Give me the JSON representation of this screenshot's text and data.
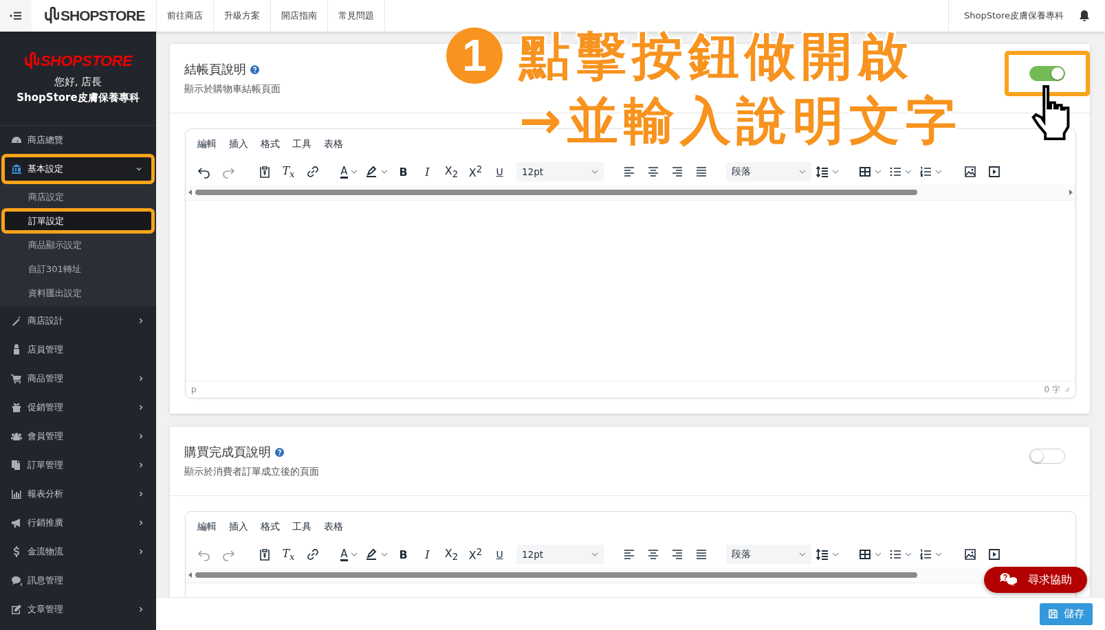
{
  "topbar": {
    "logo": "SHOPSTORE",
    "nav": [
      "前往商店",
      "升級方案",
      "開店指南",
      "常見問題"
    ],
    "store_name": "ShopStore皮膚保養專科"
  },
  "sidebar": {
    "logo": "SHOPSTORE",
    "greeting": "您好, 店長",
    "store_name": "ShopStore皮膚保養專科",
    "items": [
      {
        "kind": "dashboard",
        "label": "商店總覽",
        "selected": false,
        "highlighted": false
      },
      {
        "kind": "bank",
        "label": "基本設定",
        "selected": true,
        "highlighted": true,
        "expanded": true,
        "children": [
          {
            "label": "商店設定",
            "selected": false,
            "highlighted": false
          },
          {
            "label": "訂單設定",
            "selected": true,
            "highlighted": true
          },
          {
            "label": "商品顯示設定",
            "selected": false,
            "highlighted": false
          },
          {
            "label": "自訂301轉址",
            "selected": false,
            "highlighted": false
          },
          {
            "label": "資料匯出設定",
            "selected": false,
            "highlighted": false
          }
        ]
      },
      {
        "kind": "wand",
        "label": "商店設計",
        "selected": false,
        "highlighted": false,
        "expanded": false
      },
      {
        "kind": "user",
        "label": "店員管理",
        "selected": false,
        "highlighted": false
      },
      {
        "kind": "cart",
        "label": "商品管理",
        "selected": false,
        "highlighted": false,
        "expanded": false
      },
      {
        "kind": "gift",
        "label": "促銷管理",
        "selected": false,
        "highlighted": false,
        "expanded": false
      },
      {
        "kind": "users",
        "label": "會員管理",
        "selected": false,
        "highlighted": false,
        "expanded": false
      },
      {
        "kind": "copy",
        "label": "訂單管理",
        "selected": false,
        "highlighted": false,
        "expanded": false
      },
      {
        "kind": "chart",
        "label": "報表分析",
        "selected": false,
        "highlighted": false,
        "expanded": false
      },
      {
        "kind": "bullhorn",
        "label": "行銷推廣",
        "selected": false,
        "highlighted": false,
        "expanded": false
      },
      {
        "kind": "dollar",
        "label": "金流物流",
        "selected": false,
        "highlighted": false,
        "expanded": false
      },
      {
        "kind": "comments",
        "label": "訊息管理",
        "selected": false,
        "highlighted": false
      },
      {
        "kind": "edit",
        "label": "文章管理",
        "selected": false,
        "highlighted": false,
        "expanded": false
      }
    ]
  },
  "sections": [
    {
      "title": "結帳頁說明",
      "subtitle": "顯示於購物車結帳頁面",
      "toggle": {
        "on": true,
        "highlighted": true
      },
      "editor": {
        "menu": [
          "編輯",
          "插入",
          "格式",
          "工具",
          "表格"
        ],
        "history": [
          {
            "kind": "undo",
            "disabled": false
          },
          {
            "kind": "redo",
            "disabled": true
          }
        ],
        "glyphs": {
          "clear_format": "T$_{x}$",
          "forecolor": "A",
          "bold": "B",
          "italic": "I",
          "subscript": "X$_{2}$",
          "superscript": "X$^{2}$",
          "underline": "U"
        },
        "font_size": "12pt",
        "block": "段落",
        "status_path": "p",
        "word_count": "0 字"
      }
    },
    {
      "title": "購買完成頁說明",
      "subtitle": "顯示於消費者訂單成立後的頁面",
      "toggle": {
        "on": false,
        "highlighted": false
      },
      "editor": {
        "menu": [
          "編輯",
          "插入",
          "格式",
          "工具",
          "表格"
        ],
        "history": [
          {
            "kind": "undo",
            "disabled": true
          },
          {
            "kind": "redo",
            "disabled": true
          }
        ],
        "glyphs": {
          "clear_format": "T$_{x}$",
          "forecolor": "A",
          "bold": "B",
          "italic": "I",
          "subscript": "X$_{2}$",
          "superscript": "X$^{2}$",
          "underline": "U"
        },
        "font_size": "12pt",
        "block": "段落"
      }
    }
  ],
  "annotation": {
    "step": "1",
    "lines": [
      "點擊按鈕做開啟",
      "→並輸入說明文字"
    ]
  },
  "help_button": "尋求協助",
  "save_button": "儲存"
}
